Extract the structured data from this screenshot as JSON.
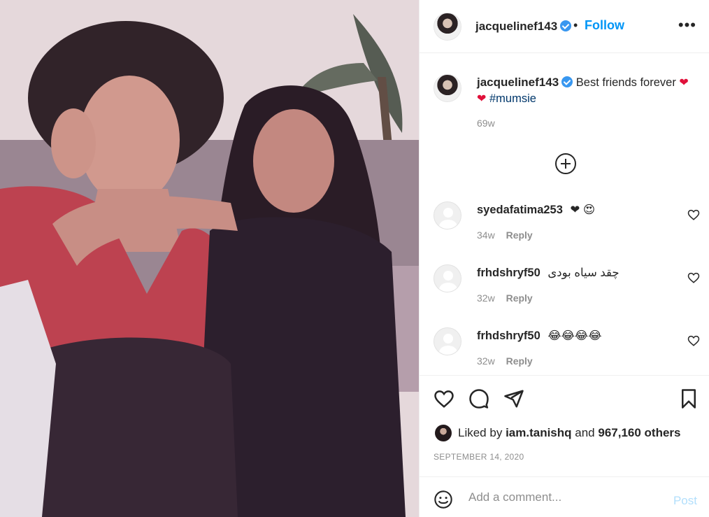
{
  "post": {
    "username": "jacquelinef143",
    "follow_label": "Follow",
    "dot": "•",
    "more_label": "•••"
  },
  "caption": {
    "username": "jacquelinef143",
    "text": "Best friends forever",
    "heart": "❤",
    "hashtag": "#mumsie",
    "time": "69w"
  },
  "comments": [
    {
      "username": "syedafatima253",
      "text": "❤ 😍",
      "time": "34w",
      "reply_label": "Reply"
    },
    {
      "username": "frhdshryf50",
      "text": "چقد سیاه بودی",
      "time": "32w",
      "reply_label": "Reply"
    },
    {
      "username": "frhdshryf50",
      "text": "😂😂😂😂",
      "time": "32w",
      "reply_label": "Reply"
    }
  ],
  "likes": {
    "prefix": "Liked by",
    "user": "iam.tanishq",
    "middle": "and",
    "count": "967,160 others"
  },
  "date": "SEPTEMBER 14, 2020",
  "add_comment": {
    "placeholder": "Add a comment...",
    "post_label": "Post"
  },
  "colors": {
    "link_blue": "#0095f6",
    "verified_blue": "#3897f0",
    "heart_red": "#e0103a",
    "muted": "#8e8e8e",
    "post_disabled": "#b2dffc"
  },
  "icons": [
    "verified-icon",
    "heart-icon",
    "comment-icon",
    "share-icon",
    "bookmark-icon",
    "emoji-icon",
    "add-circle-icon",
    "more-icon"
  ]
}
